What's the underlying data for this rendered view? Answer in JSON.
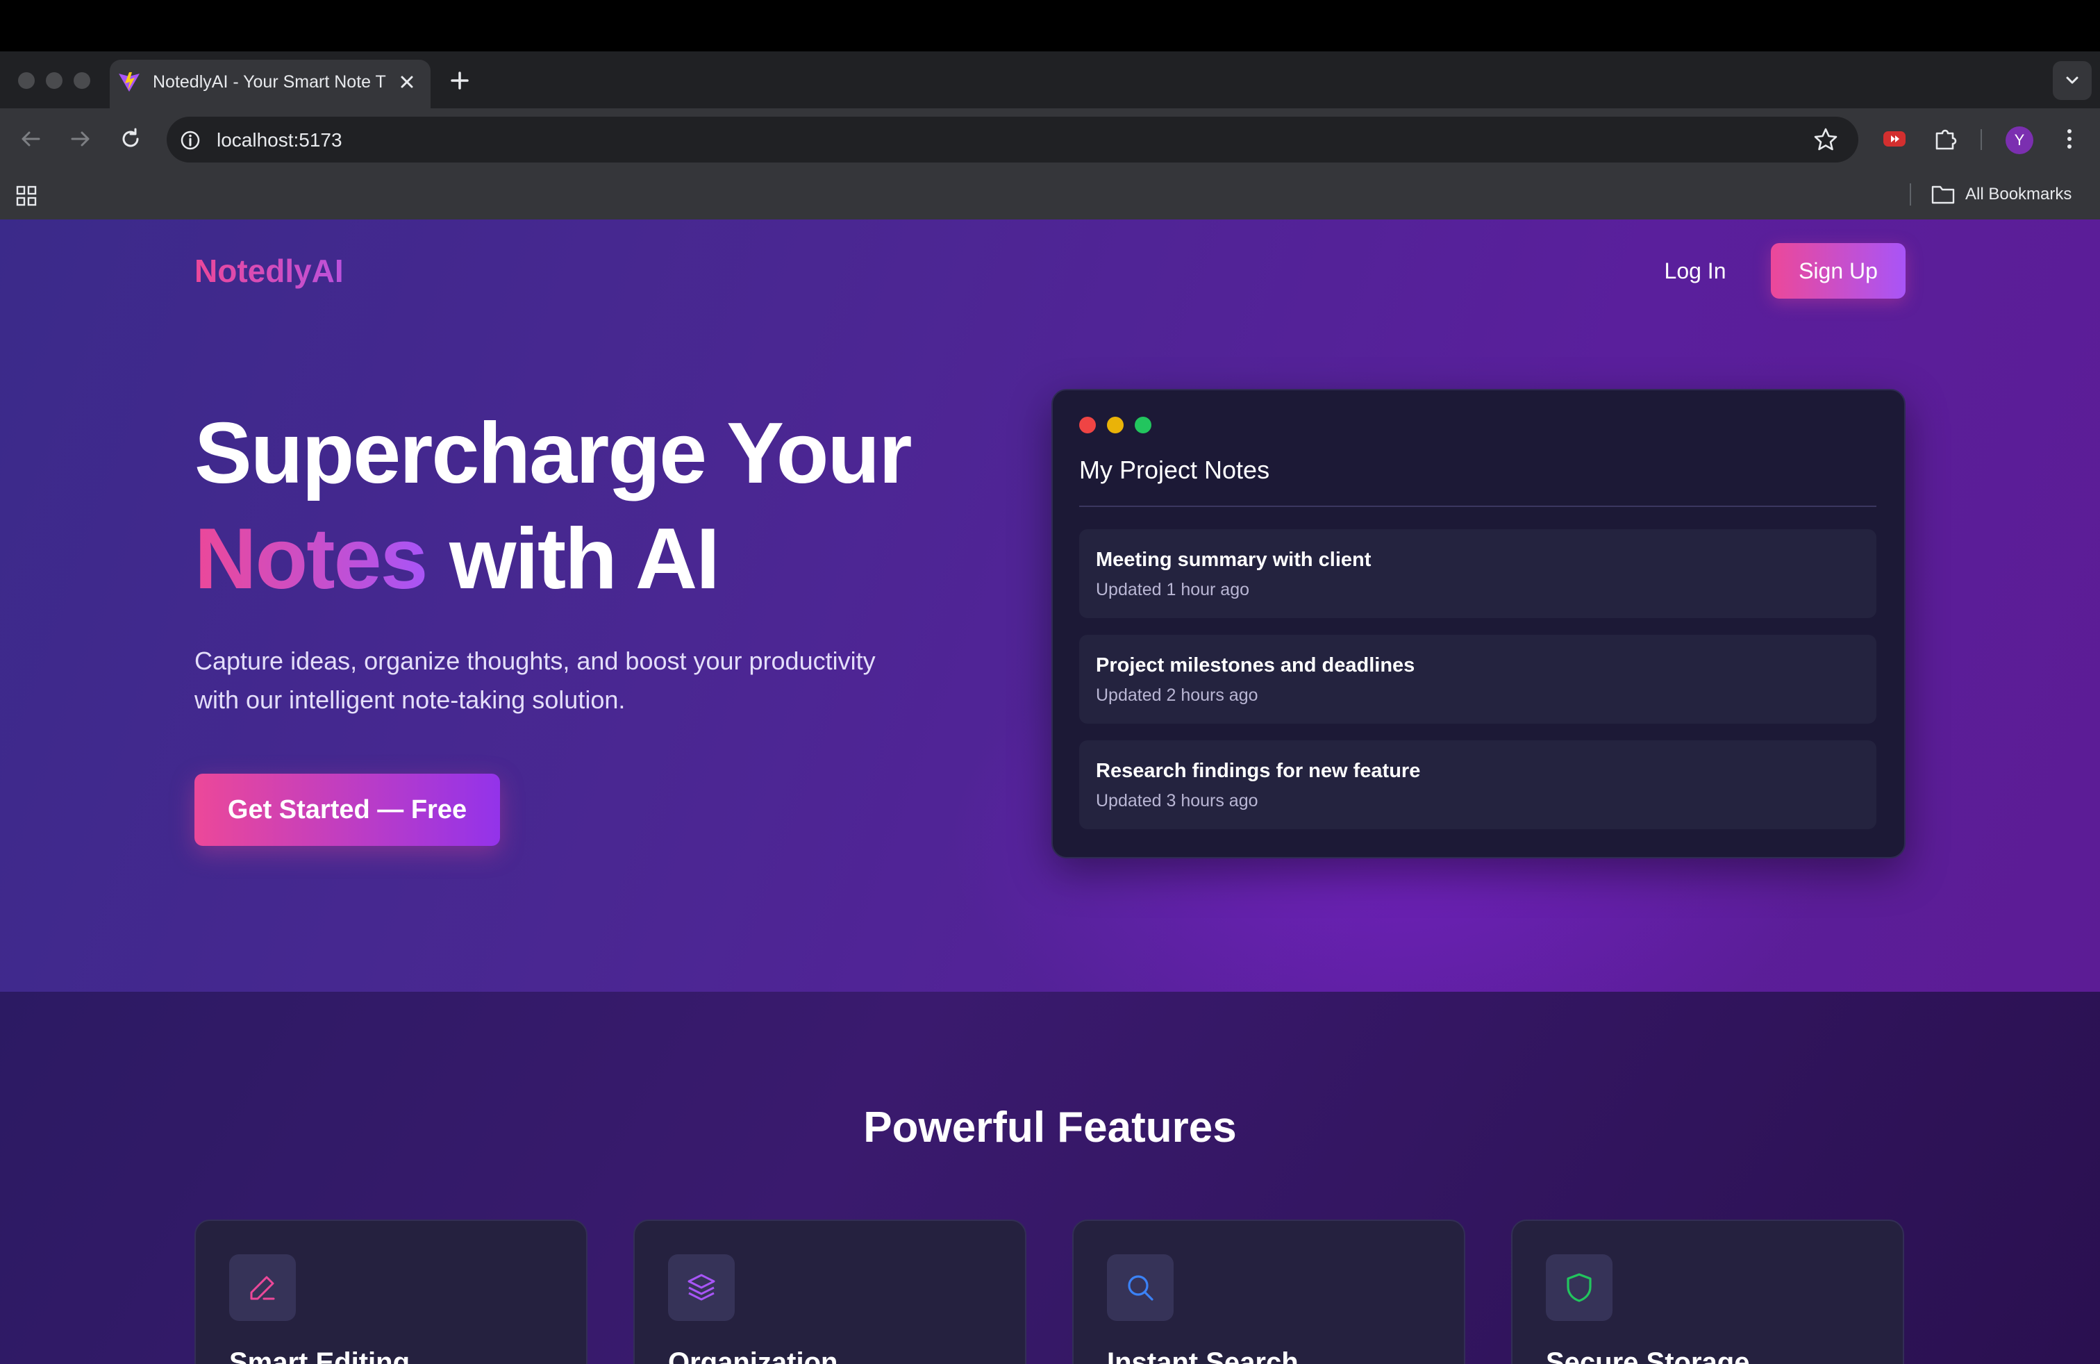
{
  "browser": {
    "tab_title": "NotedlyAI - Your Smart Note T",
    "url": "localhost:5173",
    "profile_initial": "Y",
    "bookmarks_label": "All Bookmarks"
  },
  "nav": {
    "logo": "NotedlyAI",
    "login_label": "Log In",
    "signup_label": "Sign Up"
  },
  "hero": {
    "headline_line1": "Supercharge Your",
    "headline_highlight": "Notes",
    "headline_rest": " with AI",
    "subtitle_line1": "Capture ideas, organize thoughts, and boost your productivity",
    "subtitle_line2": "with our intelligent note-taking solution.",
    "cta_label": "Get Started — Free"
  },
  "preview": {
    "title": "My Project Notes",
    "notes": [
      {
        "title": "Meeting summary with client",
        "updated": "Updated 1 hour ago"
      },
      {
        "title": "Project milestones and deadlines",
        "updated": "Updated 2 hours ago"
      },
      {
        "title": "Research findings for new feature",
        "updated": "Updated 3 hours ago"
      }
    ]
  },
  "features": {
    "heading": "Powerful Features",
    "items": [
      {
        "title": "Smart Editing",
        "icon": "pencil-icon",
        "color": "#ec4899"
      },
      {
        "title": "Organization",
        "icon": "layers-icon",
        "color": "#a855f7"
      },
      {
        "title": "Instant Search",
        "icon": "search-icon",
        "color": "#3b82f6"
      },
      {
        "title": "Secure Storage",
        "icon": "shield-icon",
        "color": "#22c55e"
      }
    ]
  },
  "colors": {
    "accent_pink": "#ec4899",
    "accent_purple": "#a855f7"
  }
}
